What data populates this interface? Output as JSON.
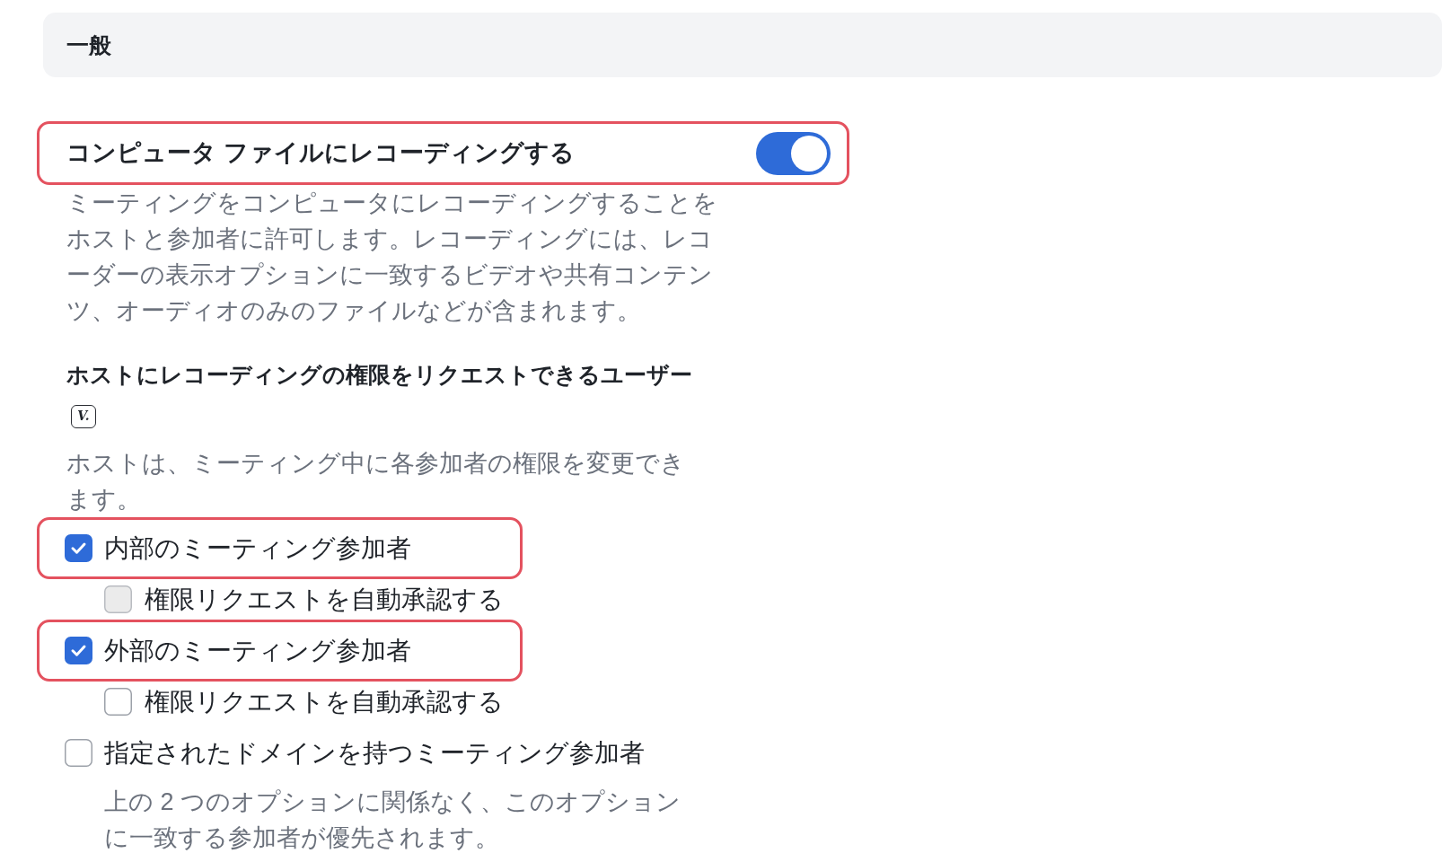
{
  "section": {
    "title": "一般"
  },
  "settings": [
    {
      "kind": "toggle",
      "label": "コンピュータ ファイルにレコーディングする",
      "on": true,
      "highlighted": true,
      "description": "ミーティングをコンピュータにレコーディングすることをホストと参加者に許可します。レコーディングには、レコーダーの表示オプションに一致するビデオや共有コンテンツ、オーディオのみのファイルなどが含まれます。"
    },
    {
      "kind": "checkbox_group",
      "heading": "ホストにレコーディングの権限をリクエストできるユーザー",
      "badge": "V.",
      "description": "ホストは、ミーティング中に各参加者の権限を変更できます。",
      "options": [
        {
          "label": "内部のミーティング参加者",
          "checked": true,
          "disabled": false,
          "highlighted": true,
          "children": [
            {
              "label": "権限リクエストを自動承認する",
              "checked": false,
              "disabled": true,
              "highlighted": false
            }
          ]
        },
        {
          "label": "外部のミーティング参加者",
          "checked": true,
          "disabled": false,
          "highlighted": true,
          "children": [
            {
              "label": "権限リクエストを自動承認する",
              "checked": false,
              "disabled": false,
              "highlighted": false
            }
          ]
        },
        {
          "label": "指定されたドメインを持つミーティング参加者",
          "checked": false,
          "disabled": false,
          "highlighted": false,
          "description": "上の 2 つのオプションに関係なく、このオプションに一致する参加者が優先されます。"
        }
      ]
    }
  ]
}
